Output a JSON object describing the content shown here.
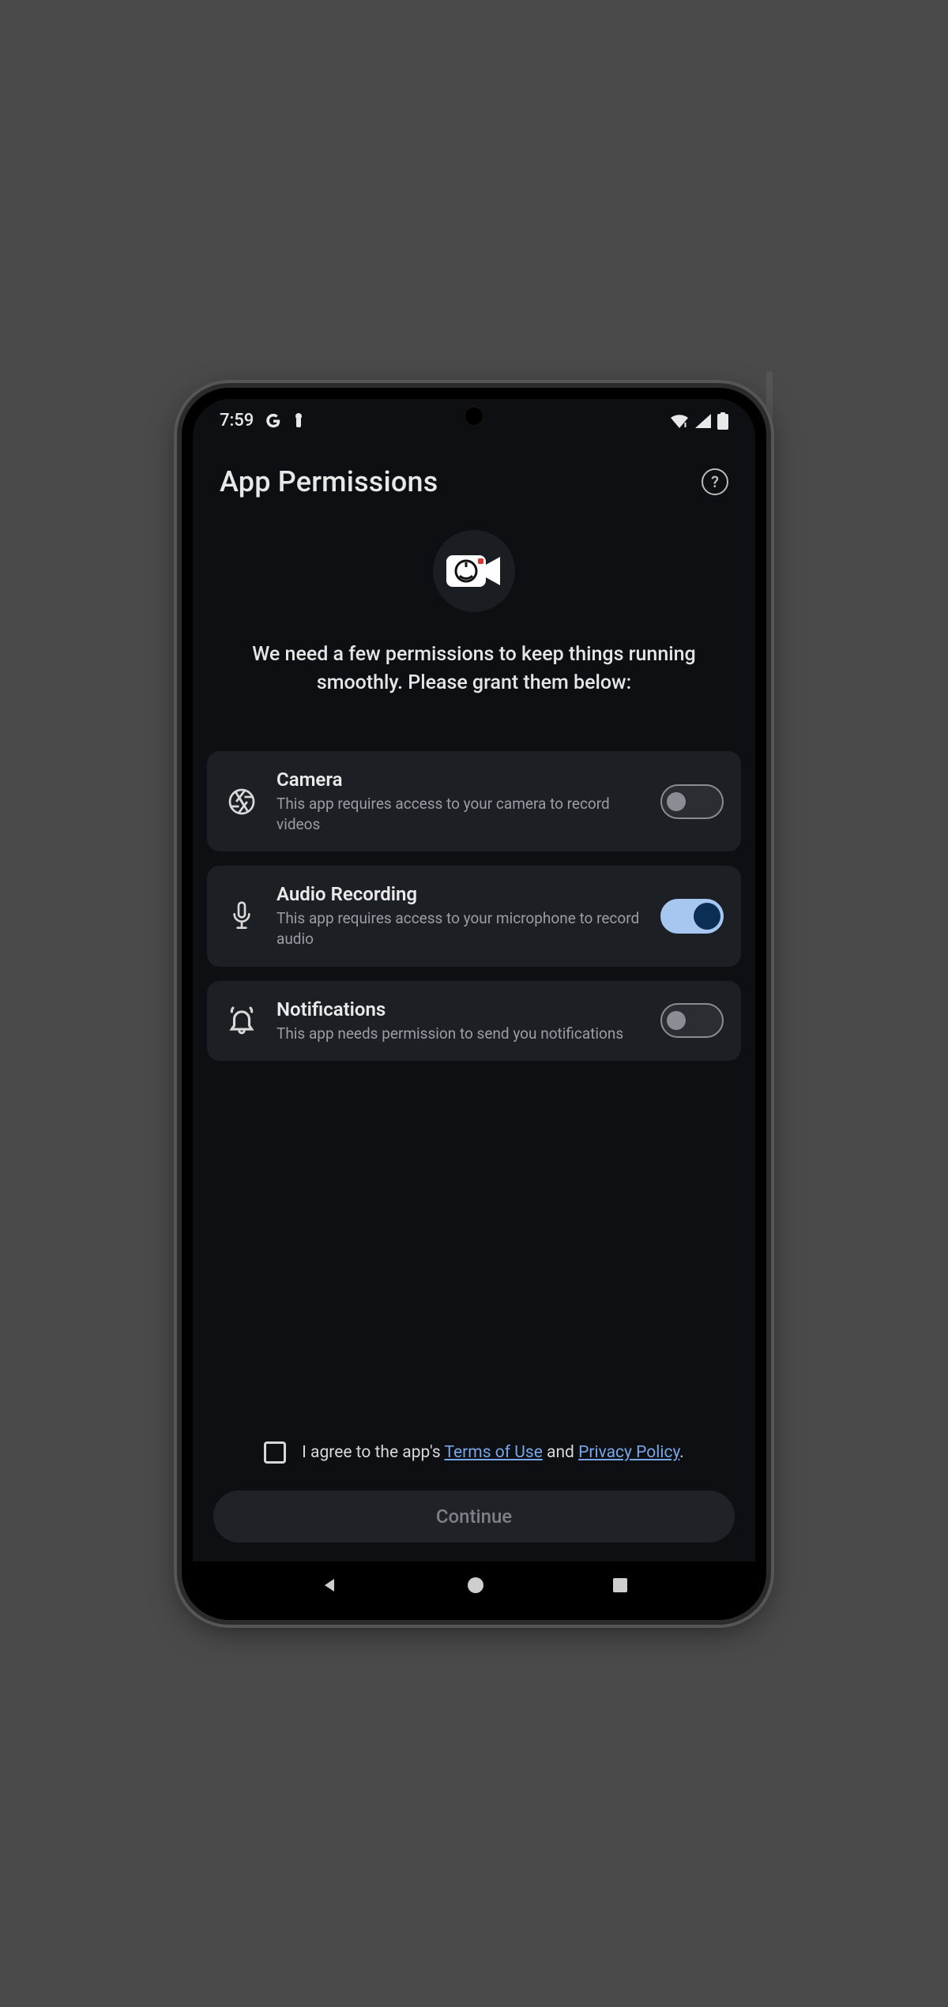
{
  "statusbar": {
    "time": "7:59"
  },
  "header": {
    "title": "App Permissions"
  },
  "hero": {
    "text": "We need a few permissions to keep things running smoothly. Please grant them below:"
  },
  "permissions": [
    {
      "icon": "aperture-icon",
      "title": "Camera",
      "desc": "This app requires access to your camera to record videos",
      "enabled": false
    },
    {
      "icon": "microphone-icon",
      "title": "Audio Recording",
      "desc": "This app requires access to your microphone to record audio",
      "enabled": true
    },
    {
      "icon": "bell-icon",
      "title": "Notifications",
      "desc": "This app needs permission to send you notifications",
      "enabled": false
    }
  ],
  "footer": {
    "agree_pre": "I agree to the app's ",
    "terms_label": "Terms of Use",
    "and": " and ",
    "privacy_label": "Privacy Policy",
    "period": ".",
    "agreed": false,
    "continue_label": "Continue"
  }
}
